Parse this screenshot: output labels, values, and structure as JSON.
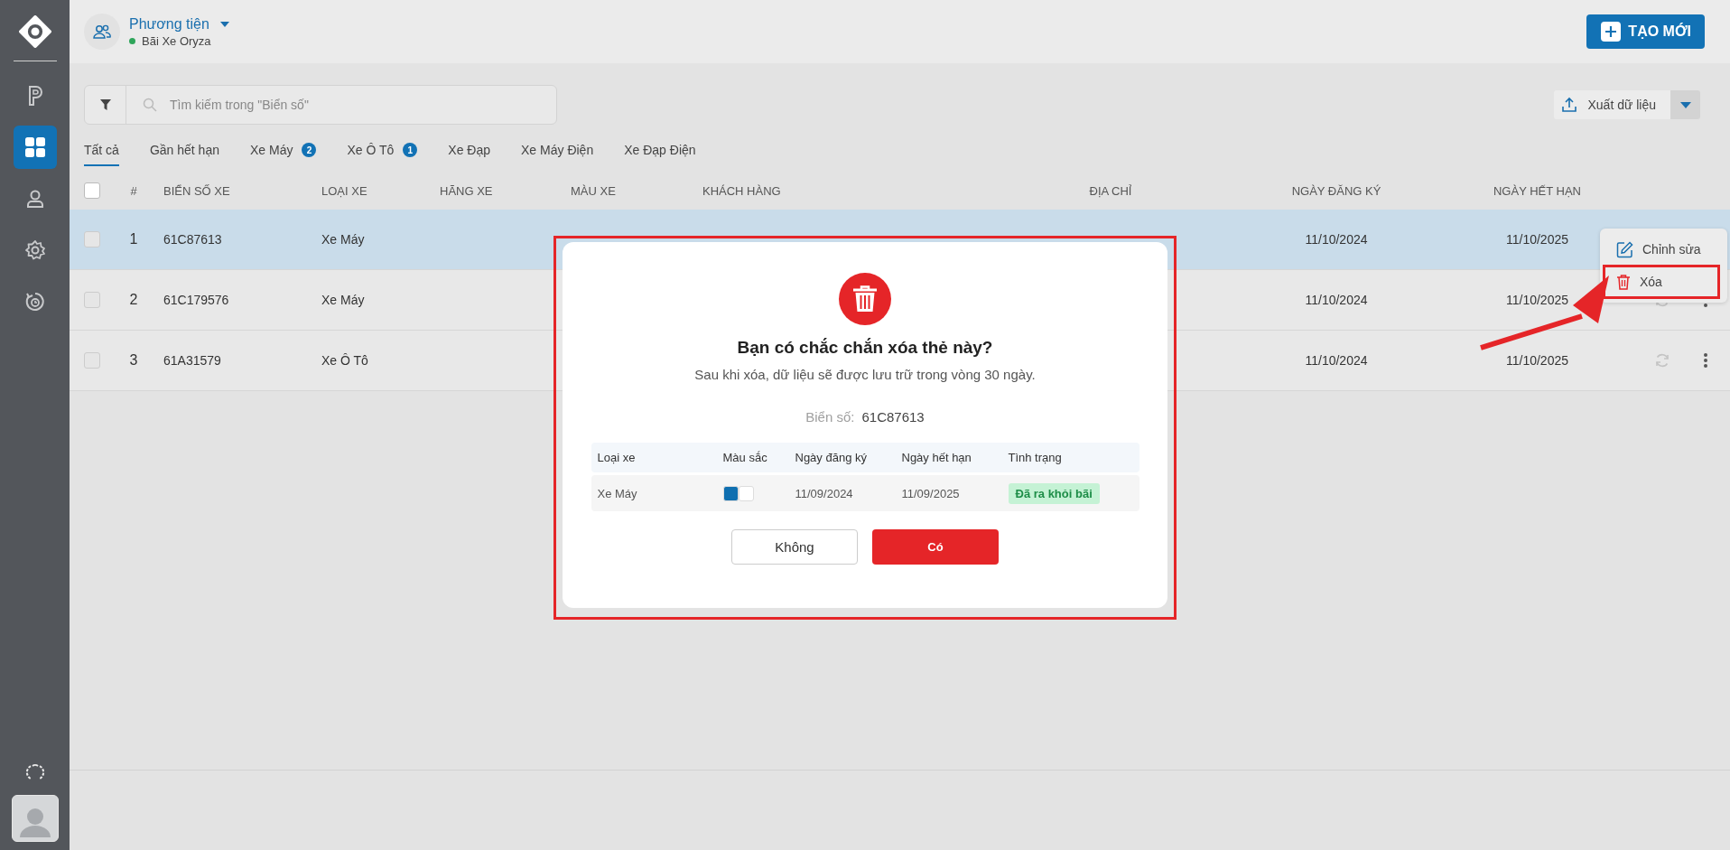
{
  "sidebar": {
    "items": [
      {
        "kind": "parking",
        "selected": false
      },
      {
        "kind": "grid",
        "selected": true
      },
      {
        "kind": "user",
        "selected": false
      },
      {
        "kind": "settings",
        "selected": false
      },
      {
        "kind": "history",
        "selected": false
      }
    ]
  },
  "header": {
    "title": "Phương tiện",
    "subtitle": "Bãi Xe Oryza",
    "create_button": "TẠO MỚI"
  },
  "search": {
    "placeholder": "Tìm kiếm trong \"Biển số\""
  },
  "export_button": "Xuất dữ liệu",
  "tabs": [
    {
      "label": "Tất cả",
      "selected": true
    },
    {
      "label": "Gần hết hạn",
      "selected": false
    },
    {
      "label": "Xe Máy",
      "badge": "2",
      "selected": false
    },
    {
      "label": "Xe Ô Tô",
      "badge": "1",
      "selected": false
    },
    {
      "label": "Xe Đạp",
      "selected": false
    },
    {
      "label": "Xe Máy Điện",
      "selected": false
    },
    {
      "label": "Xe Đạp Điện",
      "selected": false
    }
  ],
  "table": {
    "select_all": {
      "checked": false
    },
    "columns": [
      "#",
      "BIỂN SỐ XE",
      "LOẠI XE",
      "HÃNG XE",
      "MÀU XE",
      "KHÁCH HÀNG",
      "ĐỊA CHỈ",
      "NGÀY ĐĂNG KÝ",
      "NGÀY HẾT HẠN"
    ],
    "rows": [
      {
        "index": "1",
        "plate": "61C87613",
        "type": "Xe Máy",
        "registered": "11/10/2024",
        "expires": "11/10/2025",
        "selected": true,
        "checked": false
      },
      {
        "index": "2",
        "plate": "61C179576",
        "type": "Xe Máy",
        "registered": "11/10/2024",
        "expires": "11/10/2025",
        "selected": false,
        "checked": false
      },
      {
        "index": "3",
        "plate": "61A31579",
        "type": "Xe Ô Tô",
        "registered": "11/10/2024",
        "expires": "11/10/2025",
        "selected": false,
        "checked": false
      }
    ]
  },
  "context_menu": {
    "items": [
      {
        "kind": "edit",
        "label": "Chỉnh sửa",
        "annotated": false
      },
      {
        "kind": "delete",
        "label": "Xóa",
        "annotated": true
      }
    ]
  },
  "dialog": {
    "title": "Bạn có chắc chắn xóa thẻ này?",
    "message": "Sau khi xóa, dữ liệu sẽ được lưu trữ trong vòng 30 ngày.",
    "plate_label": "Biển số:",
    "plate": "61C87613",
    "columns": [
      "Loại xe",
      "Màu sắc",
      "Ngày đăng ký",
      "Ngày hết hạn",
      "Tình trạng"
    ],
    "row": {
      "type": "Xe Máy",
      "swatches": [
        {
          "color": "#0f6fb0"
        },
        {
          "color": "#ffffff"
        }
      ],
      "registered": "11/09/2024",
      "expires": "11/09/2025",
      "status": "Đã ra khỏi bãi"
    },
    "cancel_button": "Không",
    "confirm_button": "Có"
  }
}
